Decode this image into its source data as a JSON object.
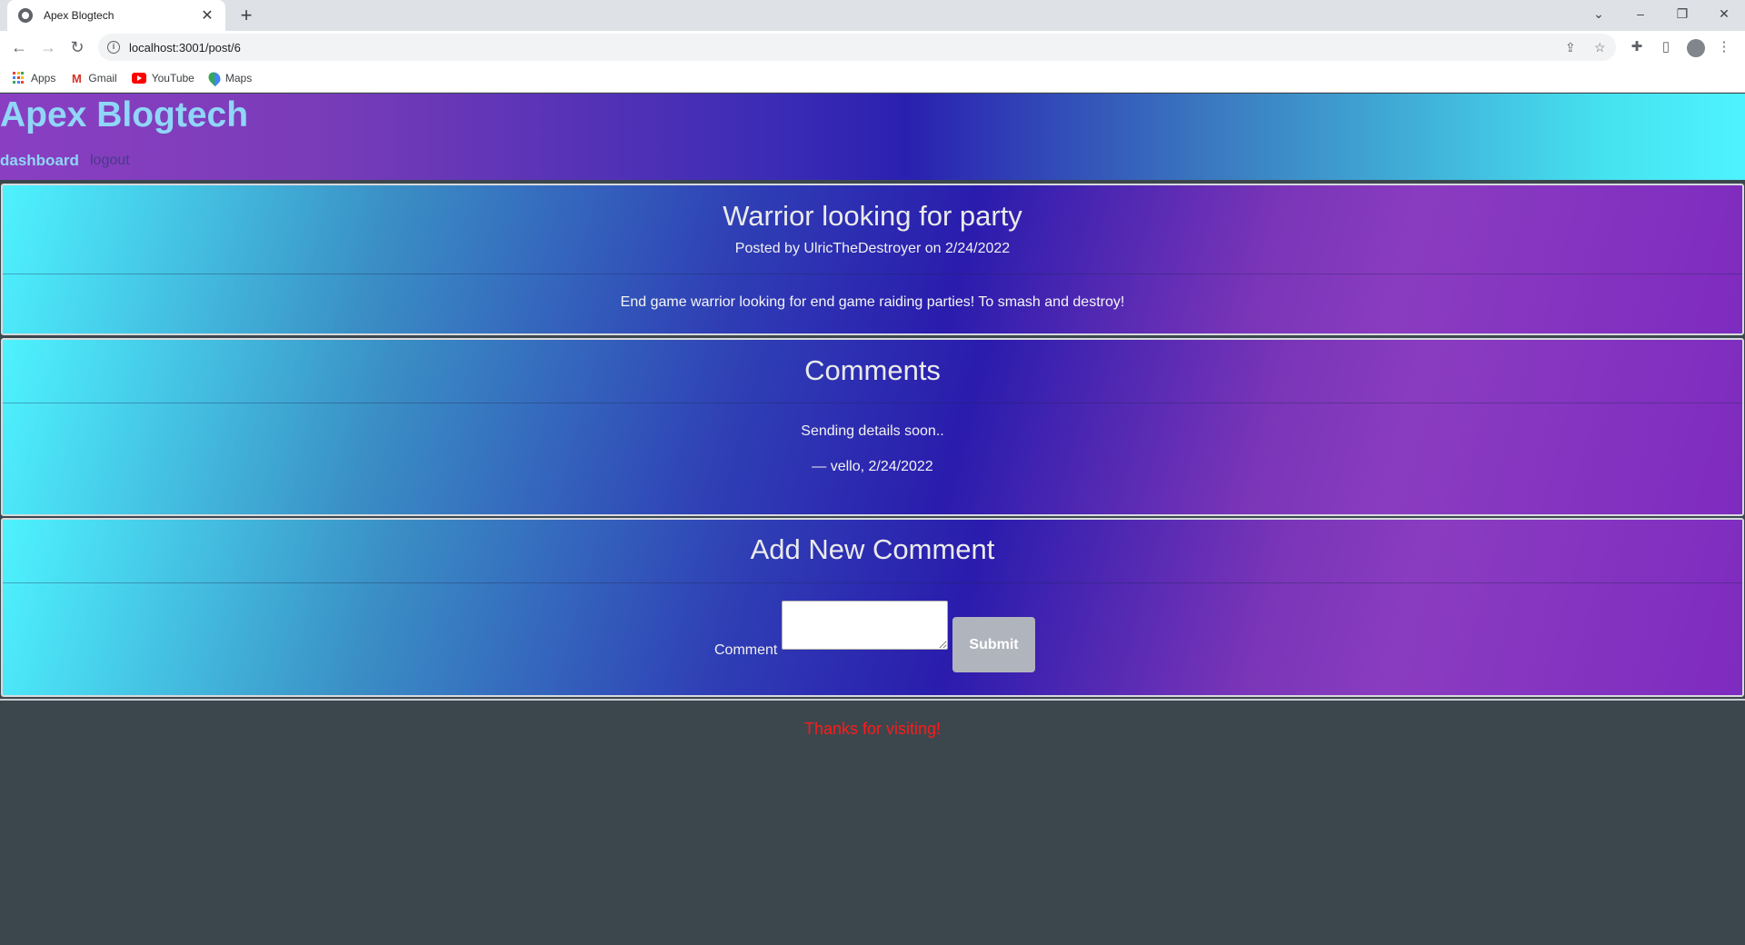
{
  "browser": {
    "tab_title": "Apex Blogtech",
    "url": "localhost:3001/post/6",
    "bookmarks": [
      {
        "label": "Apps",
        "icon": "apps-icon"
      },
      {
        "label": "Gmail",
        "icon": "gmail-icon"
      },
      {
        "label": "YouTube",
        "icon": "youtube-icon"
      },
      {
        "label": "Maps",
        "icon": "maps-icon"
      }
    ]
  },
  "site": {
    "title": "Apex Blogtech",
    "nav": {
      "dashboard": "dashboard",
      "logout": "logout"
    },
    "colors": {
      "header_text": "#8fd6f8",
      "footer_text": "#ff1a1a",
      "background": "#3c474d"
    }
  },
  "post": {
    "title": "Warrior looking for party",
    "byline": "Posted by UlricTheDestroyer on 2/24/2022",
    "body": "End game warrior looking for end game raiding parties! To smash and destroy!"
  },
  "comments": {
    "heading": "Comments",
    "items": [
      {
        "text": "Sending details soon..",
        "meta": "— vello, 2/24/2022"
      }
    ]
  },
  "new_comment": {
    "heading": "Add New Comment",
    "label": "Comment",
    "value": "",
    "submit": "Submit"
  },
  "footer": {
    "text": "Thanks for visiting!"
  }
}
